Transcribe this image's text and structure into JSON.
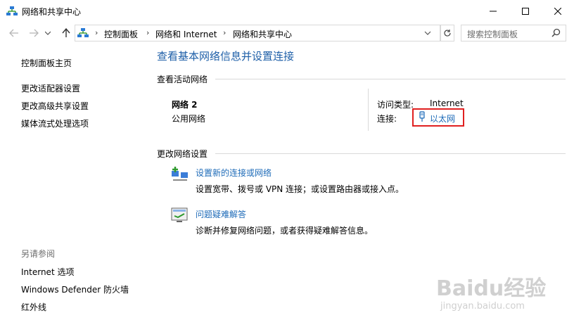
{
  "window": {
    "title": "网络和共享中心",
    "minimize_label": "—",
    "maximize_label": "☐",
    "close_label": "✕"
  },
  "address_bar": {
    "breadcrumbs": [
      "控制面板",
      "网络和 Internet",
      "网络和共享中心"
    ],
    "search_placeholder": "搜索控制面板"
  },
  "left_pane": {
    "home": "控制面板主页",
    "links": [
      "更改适配器设置",
      "更改高级共享设置",
      "媒体流式处理选项"
    ],
    "see_also_title": "另请参阅",
    "see_also": [
      "Internet 选项",
      "Windows Defender 防火墙",
      "红外线"
    ]
  },
  "main": {
    "heading": "查看基本网络信息并设置连接",
    "active_networks_title": "查看活动网络",
    "network": {
      "name": "网络 2",
      "type": "公用网络",
      "access_type_label": "访问类型:",
      "access_type_value": "Internet",
      "connections_label": "连接:",
      "connection_link": "以太网"
    },
    "change_settings_title": "更改网络设置",
    "tasks": [
      {
        "title": "设置新的连接或网络",
        "desc": "设置宽带、拨号或 VPN 连接；或设置路由器或接入点。"
      },
      {
        "title": "问题疑难解答",
        "desc": "诊断并修复网络问题，或者获得疑难解答信息。"
      }
    ]
  },
  "watermark": {
    "brand": "Baidu经验",
    "url": "jingyan.baidu.com"
  },
  "colors": {
    "heading": "#1e5fa8",
    "link": "#1e6bb8",
    "highlight_box": "#e02020"
  }
}
